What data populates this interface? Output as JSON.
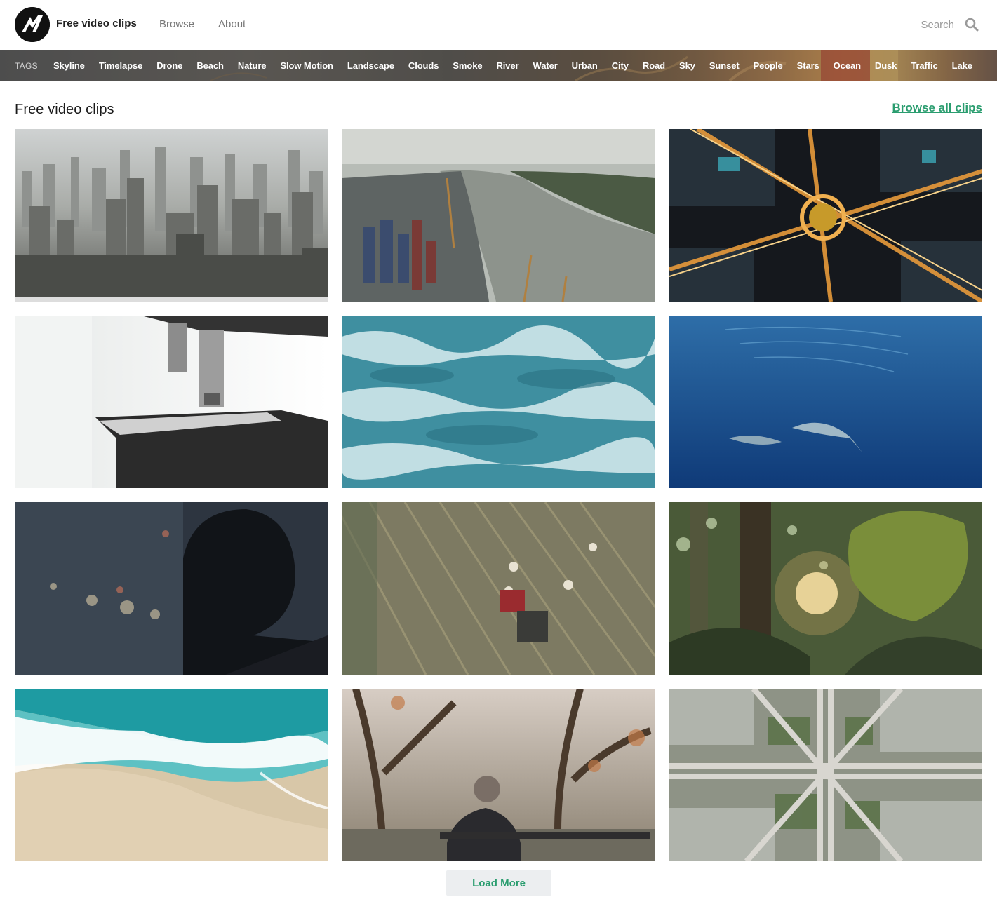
{
  "header": {
    "brand": "Free video clips",
    "nav": {
      "browse": "Browse",
      "about": "About"
    },
    "search": {
      "placeholder": "Search",
      "icon": "search-icon"
    },
    "logo": "logo-mark"
  },
  "tagbar": {
    "label": "TAGS",
    "tags": [
      "Skyline",
      "Timelapse",
      "Drone",
      "Beach",
      "Nature",
      "Slow Motion",
      "Landscape",
      "Clouds",
      "Smoke",
      "River",
      "Water",
      "Urban",
      "City",
      "Road",
      "Sky",
      "Sunset",
      "People",
      "Stars",
      "Ocean",
      "Dusk",
      "Traffic",
      "Lake"
    ]
  },
  "section": {
    "title": "Free video clips",
    "browse_all": "Browse all clips"
  },
  "clips": [
    {
      "name": "clip-city-skyline-haze"
    },
    {
      "name": "clip-river-port-containers"
    },
    {
      "name": "clip-night-roundabout-aerial"
    },
    {
      "name": "clip-microscope"
    },
    {
      "name": "clip-ocean-waves-aerial"
    },
    {
      "name": "clip-dolphins-underwater"
    },
    {
      "name": "clip-man-silhouette-city-lights"
    },
    {
      "name": "clip-tractor-field-aerial"
    },
    {
      "name": "clip-forest-sunlight-leaves"
    },
    {
      "name": "clip-wave-beach-aerial"
    },
    {
      "name": "clip-man-on-bench-park"
    },
    {
      "name": "clip-highway-interchange-aerial"
    }
  ],
  "load_more": "Load More",
  "colors": {
    "accent": "#2a9d6f",
    "brand_dark": "#111111",
    "muted_text": "#777777"
  }
}
